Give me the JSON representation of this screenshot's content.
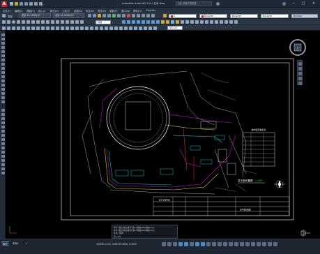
{
  "titlebar": {
    "app_icon": "A",
    "title": "Autodesk AutoCAD 2021  北京.dwg",
    "search_placeholder": "键入关键字或短语",
    "controls": [
      "─",
      "□",
      "✕"
    ]
  },
  "menu": {
    "items": [
      "文件(F)",
      "编辑(E)",
      "视图(V)",
      "插入(I)",
      "格式(O)",
      "工具(T)",
      "绘图(D)",
      "标注(N)",
      "修改(M)",
      "参数(P)",
      "窗口(W)",
      "帮助(H)",
      "Express"
    ]
  },
  "toolbar": {
    "workspace": "草图",
    "doc_tabs": [
      "北京-14-2000(1)*",
      "北京-14-2000(2)*"
    ],
    "layer_combo": "ByLayer",
    "color_combo": "ByLayer",
    "linetype_combo": "ByLayer",
    "lineweight_combo": "ByColor",
    "layer_name": "0",
    "style_combo": "标准",
    "dim_combo": "ISO-25"
  },
  "drawing": {
    "plan_title": "总平面布置图",
    "plan_scale": "1:1000",
    "table_title": "技术经济指标表",
    "title_block_label1": "北京工程咨询",
    "title_block_label2": "总平面布置图"
  },
  "command_line": {
    "lines": [
      "命令: 指定对角点或 [栏选(F)/圈围(WP)/圈交(CP)]:",
      "命令: 指定对角点或 [栏选(F)/圈围(WP)/圈交(CP)]:",
      "命令: *取消*"
    ],
    "prompt": "键入命令"
  },
  "status": {
    "layout_tabs": [
      "模型",
      "布局1",
      "+"
    ],
    "coordinates": "436462.2245, 4483193.5826, 0.0000",
    "model_label": "模型",
    "scale": "1:1"
  },
  "colors": {
    "accent": "#4a88c7",
    "brand_red": "#c0232b",
    "drawing_yellow": "#d8d800",
    "drawing_magenta": "#d000d0",
    "drawing_cyan": "#00c8c8",
    "drawing_red": "#e02020"
  }
}
